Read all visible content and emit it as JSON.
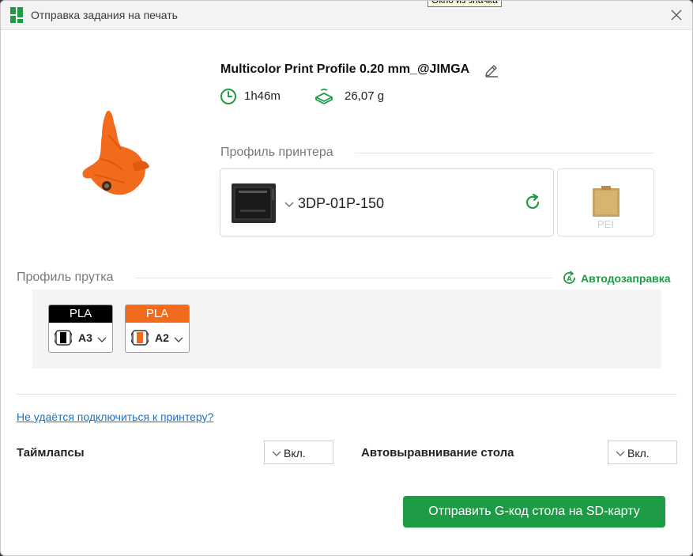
{
  "window": {
    "title": "Отправка задания на печать",
    "tooltip": "Окно из значка"
  },
  "job": {
    "profile_name": "Multicolor Print Profile 0.20 mm_@JIMGA",
    "print_time": "1h46m",
    "filament_weight": "26,07 g"
  },
  "printer_section": {
    "label": "Профиль принтера",
    "printer_name": "3DP-01P-150",
    "plate_type": "PEI"
  },
  "filament_section": {
    "label": "Профиль прутка",
    "auto_refill_label": "Автодозаправка",
    "filaments": [
      {
        "type": "PLA",
        "slot": "A3",
        "color": "#000000"
      },
      {
        "type": "PLA",
        "slot": "A2",
        "color": "#f26b1d"
      }
    ]
  },
  "connection_link": "Не удаётся подключиться к принтеру?",
  "options": {
    "timelapse": {
      "label": "Таймлапсы",
      "value": "Вкл."
    },
    "bed_leveling": {
      "label": "Автовыравнивание стола",
      "value": "Вкл."
    }
  },
  "send_button_label": "Отправить G-код стола на SD-карту",
  "colors": {
    "accent": "#1e9b45",
    "model": "#f26b1d"
  }
}
